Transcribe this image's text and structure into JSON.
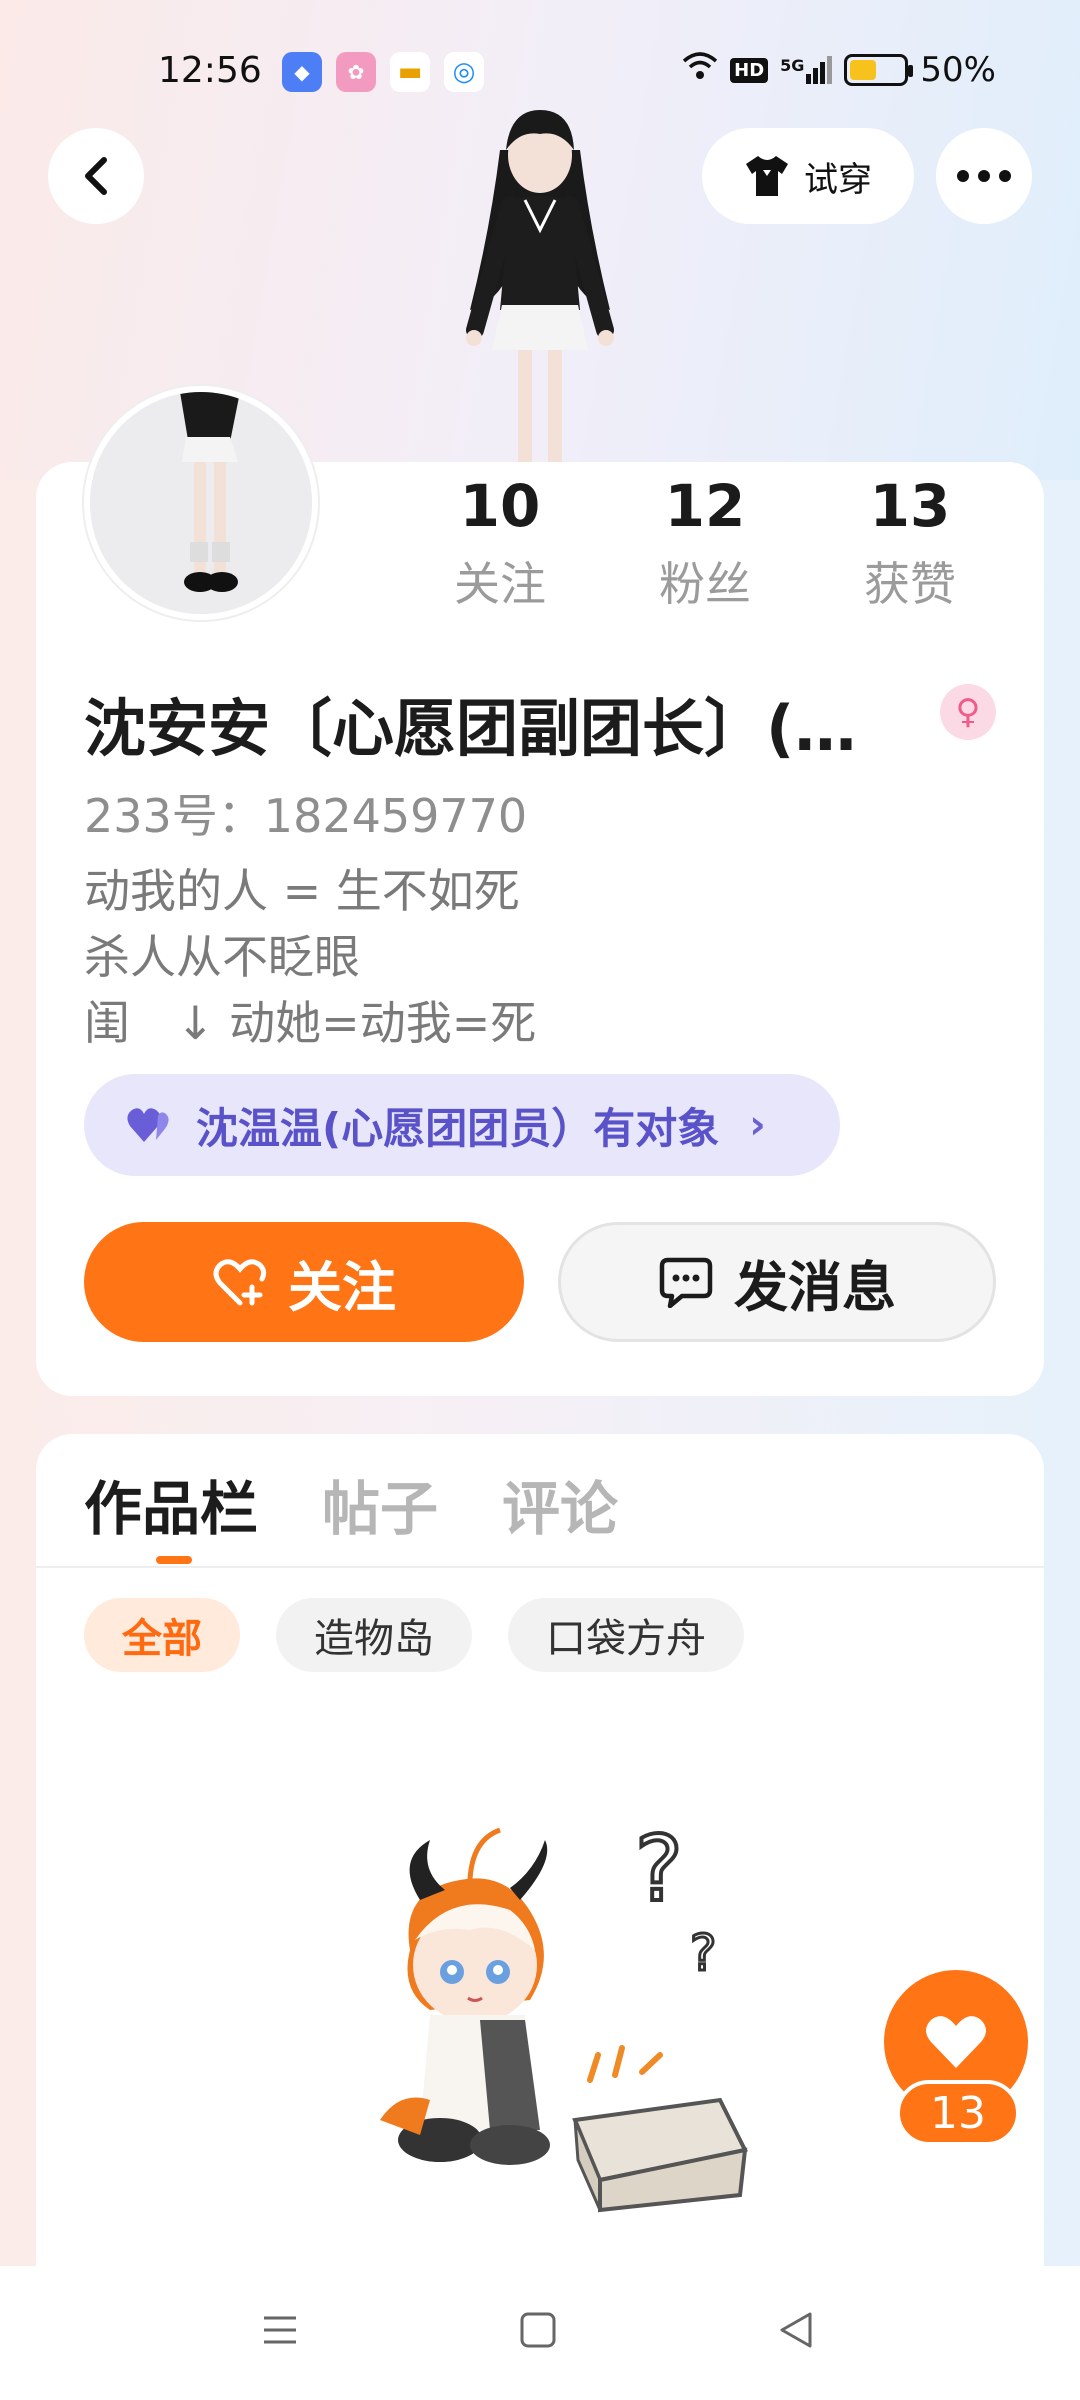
{
  "status_bar": {
    "time": "12:56",
    "signal": "5G",
    "hd": "HD",
    "battery_percent": "50%",
    "battery_level": 0.5
  },
  "header": {
    "tryon_label": "试穿"
  },
  "profile": {
    "stats": [
      {
        "value": "10",
        "label": "关注"
      },
      {
        "value": "12",
        "label": "粉丝"
      },
      {
        "value": "13",
        "label": "获赞"
      }
    ],
    "name": "沈安安〔心愿团副团长〕(…",
    "gender": "female",
    "uid": "233号：182459770",
    "bio": [
      "动我的人 = 生不如死",
      "杀人从不眨眼",
      "闺　↓ 动她=动我=死"
    ],
    "couple_chip": "沈温温(心愿团团员）有对象",
    "follow_label": "关注",
    "message_label": "发消息"
  },
  "works": {
    "tabs": [
      {
        "label": "作品栏",
        "active": true
      },
      {
        "label": "帖子",
        "active": false
      },
      {
        "label": "评论",
        "active": false
      }
    ],
    "filters": [
      {
        "label": "全部",
        "active": true
      },
      {
        "label": "造物岛",
        "active": false
      },
      {
        "label": "口袋方舟",
        "active": false
      }
    ]
  },
  "like_fab": {
    "count": "13"
  },
  "colors": {
    "accent": "#ff7414",
    "couple": "#5a52c9",
    "gender": "#ef5c8a"
  }
}
